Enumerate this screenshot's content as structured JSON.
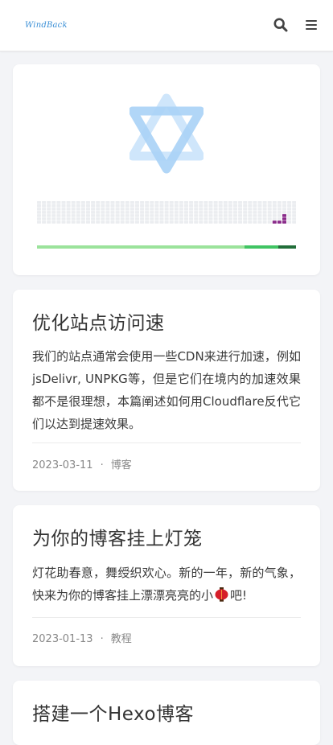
{
  "header": {
    "logo_text": "WindBack",
    "search_icon": "search-icon",
    "menu_icon": "hamburger-menu-icon"
  },
  "hero": {
    "logo_icon": "hexagram-star-icon",
    "colors": {
      "star_light": "#cfe6fb",
      "star_mid": "#a9d2f6",
      "grid_empty": "#ebedf0",
      "activity": "#8a2b8a",
      "bar_light": "#9be39b",
      "bar_mid": "#40c463",
      "bar_dark": "#216e39"
    }
  },
  "posts": [
    {
      "title": "优化站点访问速",
      "excerpt": "我们的站点通常会使用一些CDN来进行加速，例如jsDelivr, UNPKG等，但是它们在境内的加速效果都不是很理想，本篇阐述如何用Cloudflare反代它们以达到提速效果。",
      "date": "2023-03-11",
      "separator": "·",
      "category": "博客"
    },
    {
      "title": "为你的博客挂上灯笼",
      "excerpt_before": "灯花助春意，舞绶织欢心。新的一年，新的气象，快来为你的博客挂上漂漂亮亮的小",
      "excerpt_icon": "red-lantern-icon",
      "excerpt_after": "吧!",
      "date": "2023-01-13",
      "separator": "·",
      "category": "教程"
    },
    {
      "title": "搭建一个Hexo博客"
    }
  ]
}
